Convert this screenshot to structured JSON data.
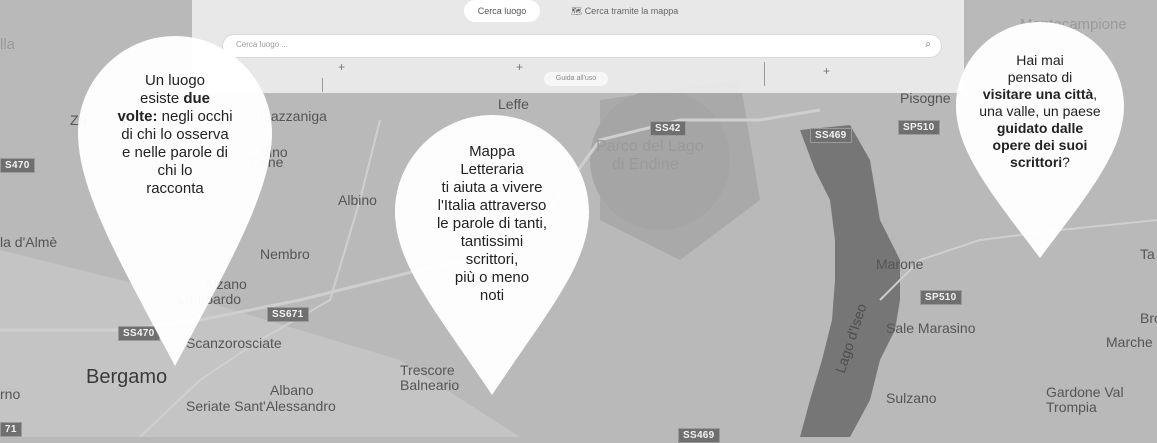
{
  "tabs": {
    "search_place": "Cerca luogo",
    "search_map": "Cerca tramite la mappa"
  },
  "search": {
    "placeholder": "Cerca luogo ..."
  },
  "guide_label": "Guida all'uso",
  "map_places": [
    "Montecampione",
    "Leffe",
    "Gazzaniga",
    "Zo",
    "SS42",
    "SS469",
    "SP510",
    "Parco del Lago",
    "di Endine",
    "Pisogne",
    "S470",
    "Albino",
    "Cene",
    "Nembro",
    "Alzano",
    "Lombardo",
    "SS671",
    "SS470",
    "Scanzorosciate",
    "Bergamo",
    "Albano",
    "Seriate Sant'Alessandro",
    "Trescore",
    "Balneario",
    "Marone",
    "SP510",
    "Sale Marasino",
    "Lago d'Iseo",
    "Sulzano",
    "Gardone Val",
    "Trompia",
    "Bro",
    "Marche",
    "Ta",
    "la d'Almè",
    "rno",
    "SS469",
    "lla",
    "vino",
    "71"
  ],
  "pins": {
    "left": {
      "l1": "Un luogo",
      "l2a": "esiste ",
      "l2b": "due",
      "l3a": "volte:",
      "l3b": " negli occhi",
      "l4": "di chi lo osserva",
      "l5": "e nelle parole di",
      "l6": "chi lo",
      "l7": "racconta"
    },
    "center": {
      "l1": "Mappa",
      "l2": "Letteraria",
      "l3": "ti aiuta a vivere",
      "l4": "l'Italia attraverso",
      "l5": "le parole di tanti,",
      "l6": "tantissimi",
      "l7": "scrittori,",
      "l8": "più o meno",
      "l9": "noti"
    },
    "right": {
      "l1": "Hai mai",
      "l2": "pensato di",
      "l3a": "visitare una città",
      "l3b": ",",
      "l4": "una valle, un paese",
      "l5": "guidato dalle",
      "l6": "opere dei suoi",
      "l7a": "scrittori",
      "l7b": "?"
    }
  },
  "colors": {
    "map": "#b9b9b9",
    "lake": "#767676",
    "pin": "#ffffff",
    "shield": "#6f6f6f"
  }
}
